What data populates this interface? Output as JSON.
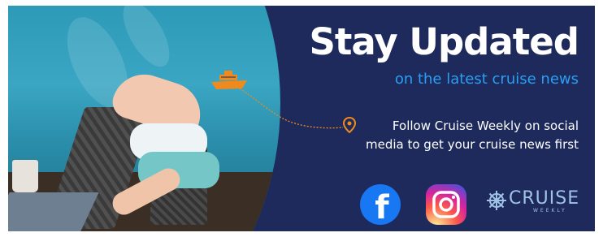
{
  "banner": {
    "title": "Stay Updated",
    "subtitle": "on the latest cruise news",
    "follow_line1": "Follow Cruise Weekly on social",
    "follow_line2": "media to get your cruise news first"
  },
  "social": {
    "facebook_letter": "f"
  },
  "logo": {
    "name": "CRUISE",
    "sub": "WEEKLY"
  },
  "colors": {
    "background": "#1d2a5b",
    "accent_blue": "#2a9ff3",
    "accent_orange": "#f08a1c",
    "facebook": "#1877f2"
  },
  "icons": [
    "cruise-ship-icon",
    "location-pin-icon",
    "facebook-icon",
    "instagram-icon",
    "ship-wheel-icon"
  ]
}
